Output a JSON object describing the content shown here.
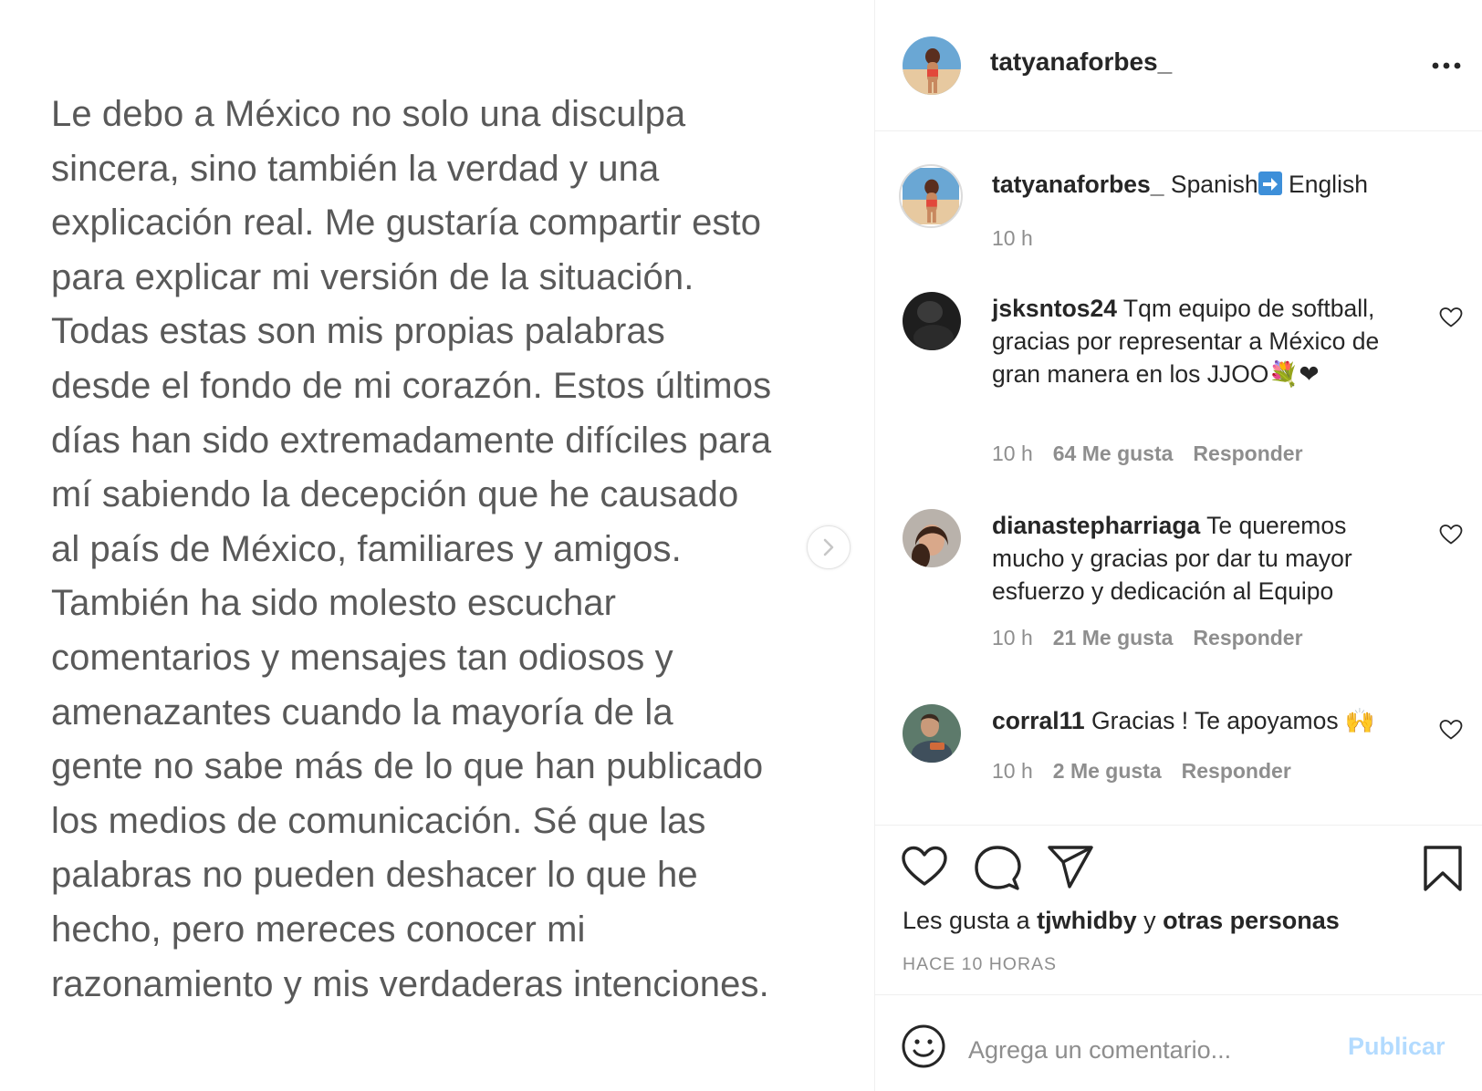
{
  "post": {
    "text_lines": [
      "Le debo a México no solo una disculpa",
      "sincera, sino también la verdad y una",
      "explicación real. Me gustaría compartir esto",
      "para explicar mi versión de la situación.",
      "Todas estas son mis propias palabras",
      "desde el fondo de mi corazón. Estos últimos",
      "días han sido extremadamente difíciles para",
      "mí sabiendo la decepción que he causado",
      "al país de México, familiares y amigos.",
      "También ha sido molesto escuchar",
      "comentarios y mensajes tan odiosos y",
      "amenazantes cuando la mayoría de la",
      "gente no sabe más de lo que han publicado",
      "los medios de comunicación. Sé que las",
      "palabras no pueden deshacer lo que he",
      "hecho, pero mereces conocer mi",
      "razonamiento y mis verdaderas intenciones."
    ]
  },
  "header": {
    "username": "tatyanaforbes_"
  },
  "caption": {
    "username": "tatyanaforbes_",
    "text_before": "Spanish",
    "text_after": "English",
    "time": "10 h"
  },
  "comments": [
    {
      "username": "jsksntos24",
      "text": "Tqm equipo de softball, gracias por representar a México de gran manera en los JJOO💐❤",
      "time": "10 h",
      "likes": "64 Me gusta",
      "reply": "Responder"
    },
    {
      "username": "dianastepharriaga",
      "text": "Te queremos mucho y gracias por dar tu mayor esfuerzo y dedicación al Equipo",
      "time": "10 h",
      "likes": "21 Me gusta",
      "reply": "Responder"
    },
    {
      "username": "corral11",
      "text": "Gracias ! Te apoyamos 🙌",
      "time": "10 h",
      "likes": "2 Me gusta",
      "reply": "Responder"
    }
  ],
  "likes": {
    "prefix": "Les gusta a",
    "user": "tjwhidby",
    "joiner": "y",
    "others": "otras personas"
  },
  "timestamp": "HACE 10 HORAS",
  "add_comment": {
    "placeholder": "Agrega un comentario...",
    "publish": "Publicar"
  },
  "colors": {
    "publish_disabled": "#b3dbff",
    "secondary_text": "#8e8e8e",
    "post_text": "#595959",
    "arrow_emoji_bg": "#3d8fd9"
  }
}
